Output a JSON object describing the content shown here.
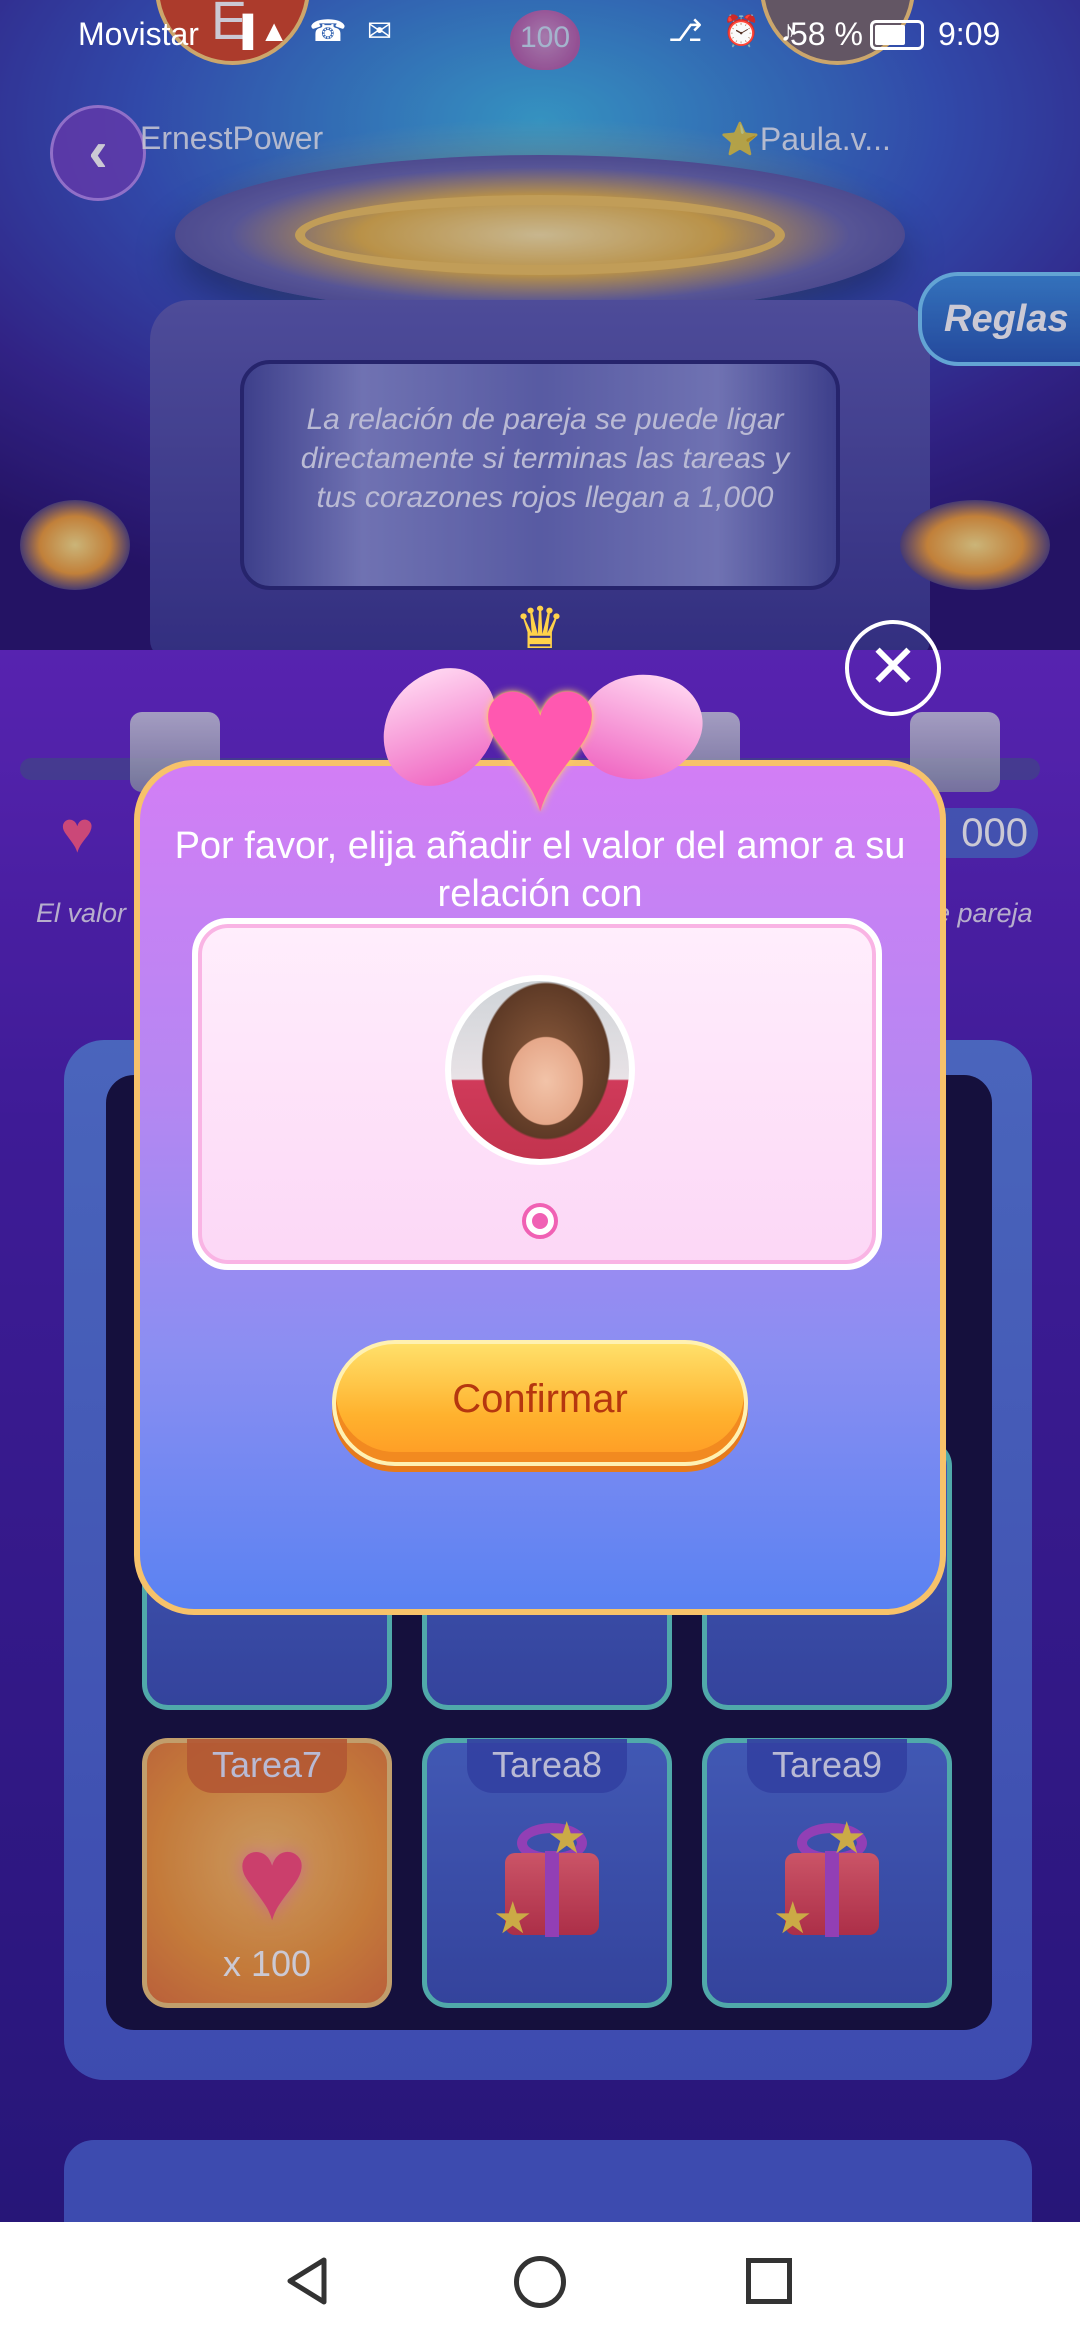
{
  "status_bar": {
    "carrier": "Movistar",
    "battery_percent": "58 %",
    "time": "9:09",
    "left_icons": "▐▲ ☎ ✉",
    "right_icons": "⎇ ⏰ ♪"
  },
  "header": {
    "left_user": {
      "name": "ErnestPower",
      "avatar_initial": "E"
    },
    "right_user": {
      "name": "⭐Paula.v..."
    },
    "heart_count": "100",
    "back_icon": "chevron-left-icon",
    "rules_label": "Reglas"
  },
  "stage": {
    "message": "La relación de pareja se puede ligar directamente si terminas las tareas y tus corazones rojos llegan a 1,000"
  },
  "progress": {
    "value_label": "000",
    "desc_left": "El valor",
    "desc_right": "e pareja"
  },
  "tasks": [
    {
      "label": "Tarea7",
      "type": "heart",
      "qty": "x 100"
    },
    {
      "label": "Tarea8",
      "type": "gift"
    },
    {
      "label": "Tarea9",
      "type": "gift"
    }
  ],
  "modal": {
    "title": "Por favor, elija añadir el valor del amor a su relación con",
    "confirm_label": "Confirmar",
    "close_icon": "close-icon",
    "candidate": {
      "selected": true
    }
  },
  "colors": {
    "modal_top": "#d27ef5",
    "modal_bottom": "#5a82f2",
    "confirm_text": "#b5370f",
    "accent_pink": "#f061b4"
  }
}
